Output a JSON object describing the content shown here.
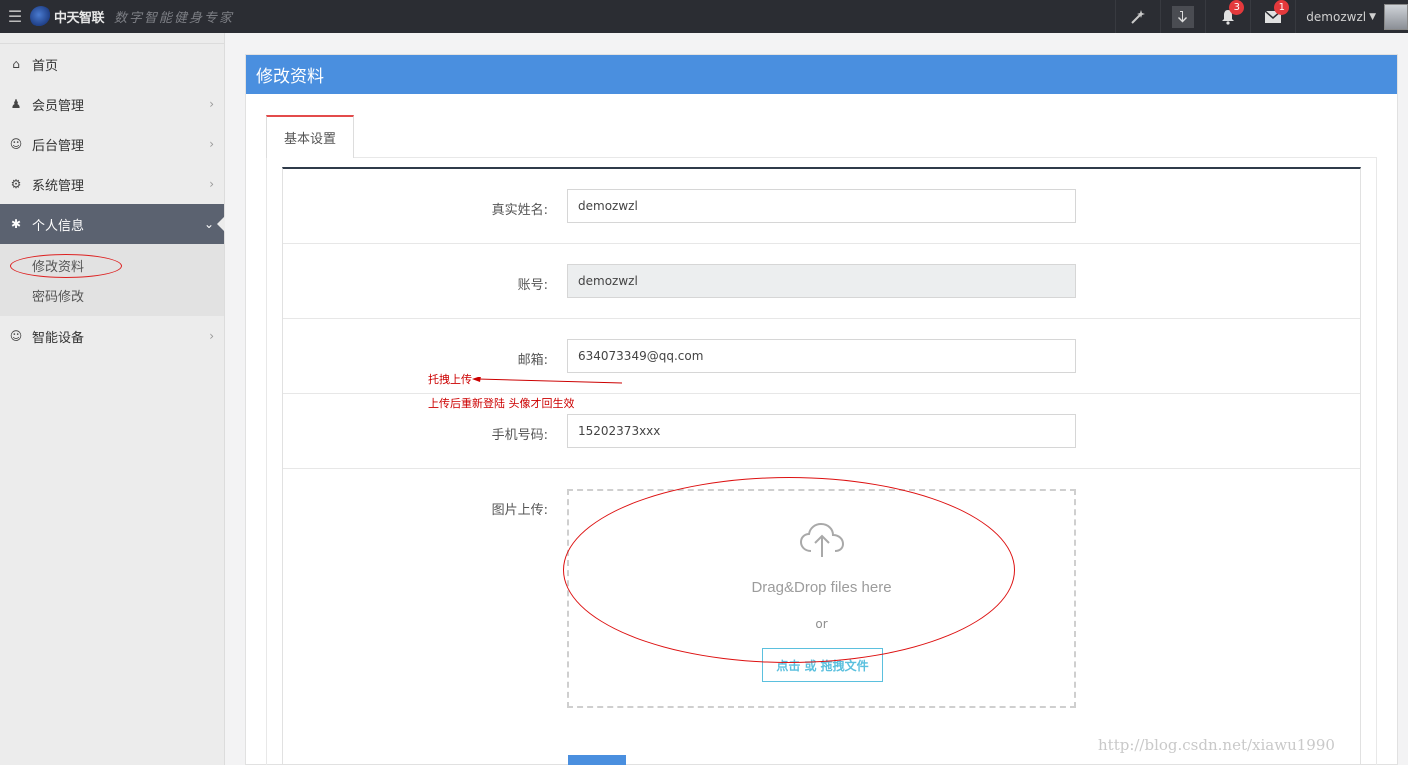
{
  "topbar": {
    "logo_name": "中天智联",
    "logo_slogan": "数字智能健身专家",
    "notifications_count": "3",
    "messages_count": "1",
    "username": "demozwzl"
  },
  "sidebar": {
    "items": [
      {
        "label": "首页"
      },
      {
        "label": "会员管理"
      },
      {
        "label": "后台管理"
      },
      {
        "label": "系统管理"
      },
      {
        "label": "个人信息"
      },
      {
        "label": "智能设备"
      }
    ],
    "sub_items": [
      {
        "label": "修改资料"
      },
      {
        "label": "密码修改"
      }
    ]
  },
  "panel": {
    "title": "修改资料",
    "tab_label": "基本设置"
  },
  "form": {
    "real_name_label": "真实姓名:",
    "real_name_value": "demozwzl",
    "account_label": "账号:",
    "account_value": "demozwzl",
    "email_label": "邮箱:",
    "email_value": "634073349@qq.com",
    "phone_label": "手机号码:",
    "phone_value": "15202373xxx",
    "image_label": "图片上传:",
    "dropzone_text": "Drag&Drop files here",
    "dropzone_or": "or",
    "dropzone_button": "点击 或 拖拽文件"
  },
  "annotations": {
    "note1": "托拽上传",
    "note2": "上传后重新登陆 头像才回生效",
    "color": "#cc0000"
  },
  "watermark": "http://blog.csdn.net/xiawu1990",
  "colors": {
    "primary": "#4a8fdf",
    "topbar": "#2b2d33",
    "sidebar_active": "#5b6270",
    "badge": "#e4393c"
  }
}
